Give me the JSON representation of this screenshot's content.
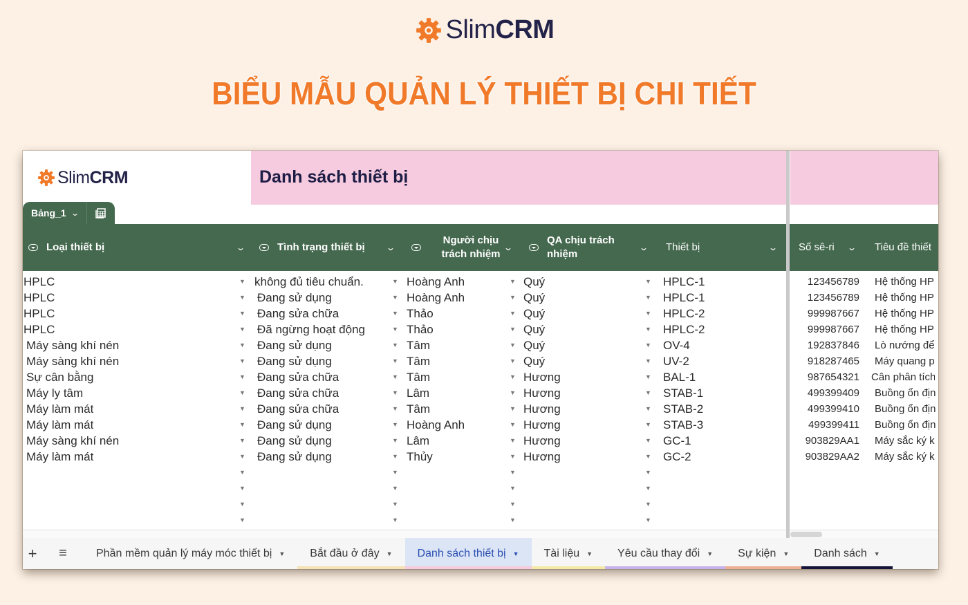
{
  "brand": {
    "name_light": "Slim",
    "name_bold": "CRM",
    "logo_color": "#f07a2a"
  },
  "page_title": "BIỂU MẪU QUẢN LÝ THIẾT BỊ CHI TIẾT",
  "sheet": {
    "banner_title": "Danh sách thiết bị",
    "table_name": "Bảng_1",
    "columns": [
      {
        "label": "Loại thiết bị",
        "type": "dropdown"
      },
      {
        "label": "Tình trạng thiết bị",
        "type": "dropdown"
      },
      {
        "label": "Người chịu trách nhiệm",
        "type": "dropdown"
      },
      {
        "label": "QA chịu trách nhiệm",
        "type": "dropdown"
      },
      {
        "label": "Thiết bị",
        "type": "text"
      },
      {
        "label": "Số sê-ri",
        "type": "text"
      },
      {
        "label": "Tiêu đề thiết",
        "type": "text"
      }
    ],
    "rows": [
      [
        "HPLC",
        "không đủ tiêu chuẩn.",
        "Hoàng Anh",
        "Quý",
        "HPLC-1",
        "123456789",
        "Hệ thống HP"
      ],
      [
        "HPLC",
        "Đang sử dụng",
        "Hoàng Anh",
        "Quý",
        "HPLC-1",
        "123456789",
        "Hệ thống HP"
      ],
      [
        "HPLC",
        "Đang sửa chữa",
        "Thảo",
        "Quý",
        "HPLC-2",
        "999987667",
        "Hệ thống HP"
      ],
      [
        "HPLC",
        "Đã ngừng hoạt động",
        "Thảo",
        "Quý",
        "HPLC-2",
        "999987667",
        "Hệ thống HP"
      ],
      [
        "Máy sàng khí nén",
        "Đang sử dụng",
        "Tâm",
        "Quý",
        "OV-4",
        "192837846",
        "Lò nướng để"
      ],
      [
        "Máy sàng khí nén",
        "Đang sử dụng",
        "Tâm",
        "Quý",
        "UV-2",
        "918287465",
        "Máy quang p"
      ],
      [
        "Sự cân bằng",
        "Đang sửa chữa",
        "Tâm",
        "Hương",
        "BAL-1",
        "987654321",
        "Cân phân tích"
      ],
      [
        "Máy ly tâm",
        "Đang sửa chữa",
        "Lâm",
        "Hương",
        "STAB-1",
        "499399409",
        "Buồng ổn địn"
      ],
      [
        "Máy làm mát",
        "Đang sửa chữa",
        "Tâm",
        "Hương",
        "STAB-2",
        "499399410",
        "Buồng ổn địn"
      ],
      [
        "Máy làm mát",
        "Đang sử dụng",
        "Hoàng Anh",
        "Hương",
        "STAB-3",
        "499399411",
        "Buồng ổn địn"
      ],
      [
        "Máy sàng khí nén",
        "Đang sử dụng",
        "Lâm",
        "Hương",
        "GC-1",
        "903829AA1",
        "Máy sắc ký k"
      ],
      [
        "Máy làm mát",
        "Đang sử dụng",
        "Thủy",
        "Hương",
        "GC-2",
        "903829AA2",
        "Máy sắc ký k"
      ]
    ],
    "empty_rows": 4
  },
  "tabs": {
    "add_label": "+",
    "menu_label": "≡",
    "items": [
      {
        "label": "Phần mềm quản lý máy móc thiết bị",
        "color": "",
        "active": false
      },
      {
        "label": "Bắt đầu ở đây",
        "color": "#f5e3b5",
        "active": false
      },
      {
        "label": "Danh sách thiết bị",
        "color": "#f6cbdf",
        "active": true
      },
      {
        "label": "Tài liệu",
        "color": "#f5e9a8",
        "active": false
      },
      {
        "label": "Yêu cầu thay đổi",
        "color": "#c6b3ec",
        "active": false
      },
      {
        "label": "Sự kiện",
        "color": "#eeb196",
        "active": false
      },
      {
        "label": "Danh sách",
        "color": "#14143a",
        "active": false
      }
    ]
  },
  "colors": {
    "header_green": "#45694f",
    "banner_pink": "#f6cbdf",
    "title_orange": "#f07a2a"
  }
}
